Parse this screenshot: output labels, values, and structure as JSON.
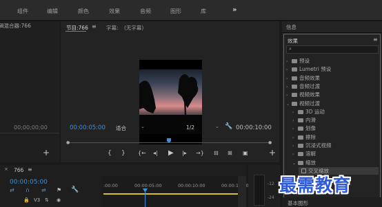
{
  "topbar": {
    "tabs": [
      "组件",
      "编辑",
      "颜色",
      "效果",
      "音频",
      "图形",
      "库"
    ],
    "more": "»"
  },
  "source": {
    "title": "辑混合器:766",
    "timecode": "00;00;00;00"
  },
  "program": {
    "title": "节目:766",
    "menu": "≡",
    "caption_label": "字幕:",
    "caption_value": "(无字幕)",
    "timecode": "00:00:05:00",
    "fit": "适合",
    "resolution": "1/2",
    "duration": "00:00:10:00",
    "add": "+"
  },
  "effects": {
    "info_title": "信息",
    "title": "效果",
    "menu": "≡",
    "search_placeholder": "",
    "items": [
      {
        "label": "预设",
        "level": 0,
        "expanded": false
      },
      {
        "label": "Lumetri 预设",
        "level": 0,
        "expanded": false
      },
      {
        "label": "音频效果",
        "level": 0,
        "expanded": false
      },
      {
        "label": "音频过渡",
        "level": 0,
        "expanded": false
      },
      {
        "label": "视频效果",
        "level": 0,
        "expanded": false
      },
      {
        "label": "视频过渡",
        "level": 0,
        "expanded": true
      },
      {
        "label": "3D 运动",
        "level": 1,
        "expanded": false
      },
      {
        "label": "内滑",
        "level": 1,
        "expanded": false
      },
      {
        "label": "划像",
        "level": 1,
        "expanded": false
      },
      {
        "label": "擦除",
        "level": 1,
        "expanded": false
      },
      {
        "label": "沉浸式视频",
        "level": 1,
        "expanded": false
      },
      {
        "label": "溶解",
        "level": 1,
        "expanded": false
      },
      {
        "label": "缩放",
        "level": 1,
        "expanded": true
      },
      {
        "label": "交叉缩放",
        "level": 2,
        "expanded": false
      }
    ],
    "footer": "基本图形"
  },
  "timeline": {
    "title": "766",
    "menu": "≡",
    "timecode": "00:00:05:00",
    "ruler": [
      ":00:00",
      "00:00:05:00",
      "00:00:10:00",
      "00:00:15:00"
    ],
    "track_label": "V3"
  },
  "watermark": "最需教育"
}
